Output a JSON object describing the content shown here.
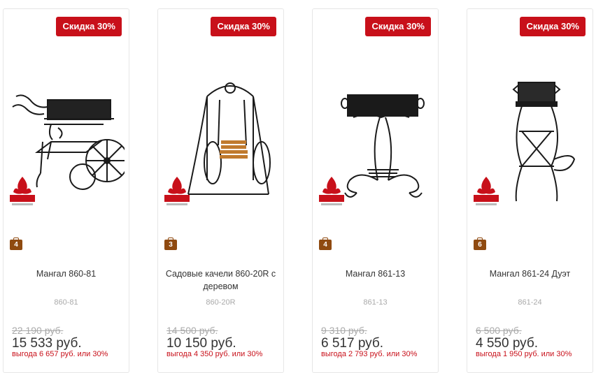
{
  "products": [
    {
      "badge": "Скидка 30%",
      "stock": "4",
      "name": "Мангал 860-81",
      "sku": "860-81",
      "old_price": "22 190 руб.",
      "price": "15 533 руб.",
      "savings": "выгода 6 657 руб. или 30%",
      "image": "bbq-cart-icon"
    },
    {
      "badge": "Скидка 30%",
      "stock": "3",
      "name": "Садовые качели 860-20R с деревом",
      "sku": "860-20R",
      "old_price": "14 500 руб.",
      "price": "10 150 руб.",
      "savings": "выгода 4 350 руб. или 30%",
      "image": "garden-swing-icon"
    },
    {
      "badge": "Скидка 30%",
      "stock": "4",
      "name": "Мангал 861-13",
      "sku": "861-13",
      "old_price": "9 310 руб.",
      "price": "6 517 руб.",
      "savings": "выгода 2 793 руб. или 30%",
      "image": "bbq-scroll-icon"
    },
    {
      "badge": "Скидка 30%",
      "stock": "6",
      "name": "Мангал 861-24 Дуэт",
      "sku": "861-24",
      "old_price": "6 500 руб.",
      "price": "4 550 руб.",
      "savings": "выгода 1 950 руб. или 30%",
      "image": "bbq-stand-icon"
    }
  ],
  "colors": {
    "badge": "#c8101a",
    "stock": "#8f4a10",
    "price": "#333333",
    "old_price": "#aaaaaa"
  }
}
